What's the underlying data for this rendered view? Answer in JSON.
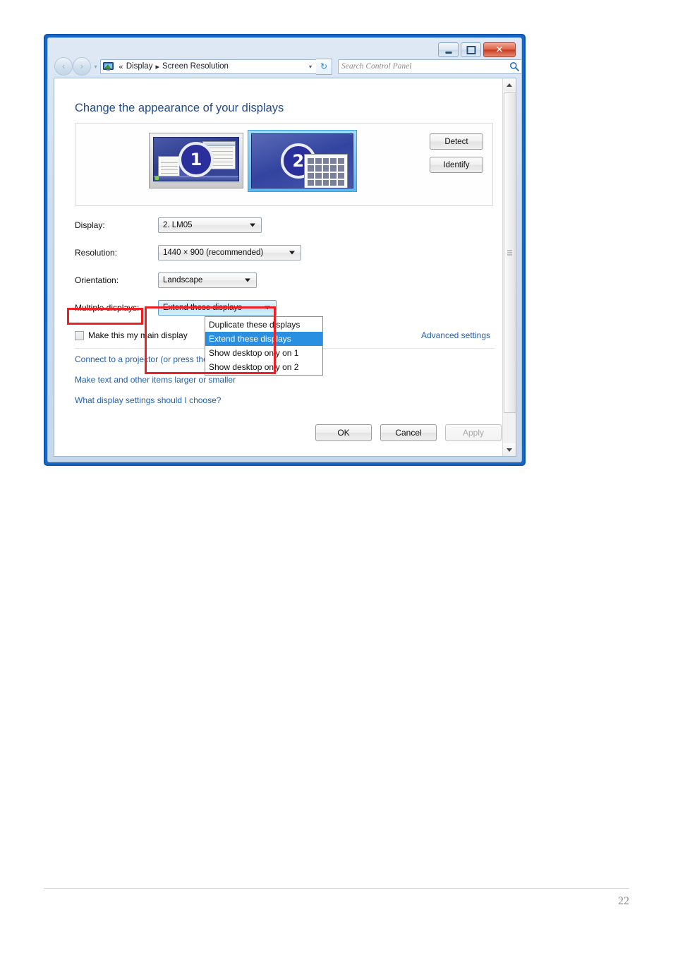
{
  "window": {
    "controls": {
      "minimize": "minimize-button",
      "maximize": "maximize-button",
      "close_glyph": "✕"
    },
    "nav": {
      "back_glyph": "‹",
      "forward_glyph": "›",
      "history_glyph": "▾",
      "address_icon": "display-icon",
      "breadcrumb_prefix": "«",
      "breadcrumb": [
        "Display",
        "Screen Resolution"
      ],
      "breadcrumb_separator": "▸",
      "address_dropdown_glyph": "▾",
      "refresh_glyph": "↻",
      "search_placeholder": "Search Control Panel"
    }
  },
  "main": {
    "heading": "Change the appearance of your displays",
    "preview": {
      "monitor1_label": "1",
      "monitor2_label": "2",
      "detect_button": "Detect",
      "identify_button": "Identify"
    },
    "fields": {
      "display_label": "Display:",
      "display_value": "2. LM05",
      "resolution_label": "Resolution:",
      "resolution_value": "1440 × 900 (recommended)",
      "orientation_label": "Orientation:",
      "orientation_value": "Landscape",
      "multiple_label": "Multiple displays:",
      "multiple_value": "Extend these displays"
    },
    "dropdown_options": [
      "Duplicate these displays",
      "Extend these displays",
      "Show desktop only on 1",
      "Show desktop only on 2"
    ],
    "selected_option_index": 1,
    "checkbox_label": "Make this my main display",
    "advanced_settings_link": "Advanced settings",
    "links": [
      "Connect to a projector (or press the  Windows logo key  + tap P)",
      "Make text and other items larger or smaller",
      "What display settings should I choose?"
    ],
    "footer_buttons": {
      "ok": "OK",
      "cancel": "Cancel",
      "apply": "Apply"
    }
  },
  "document": {
    "page_number": "22"
  },
  "colors": {
    "window_border": "#1868c4",
    "heading_blue": "#1f4c8c",
    "link_blue": "#2460ab",
    "highlight_blue": "#2a8fe0",
    "annotation_red": "#ef1f23",
    "monitor_badge": "#2a2f9c"
  }
}
